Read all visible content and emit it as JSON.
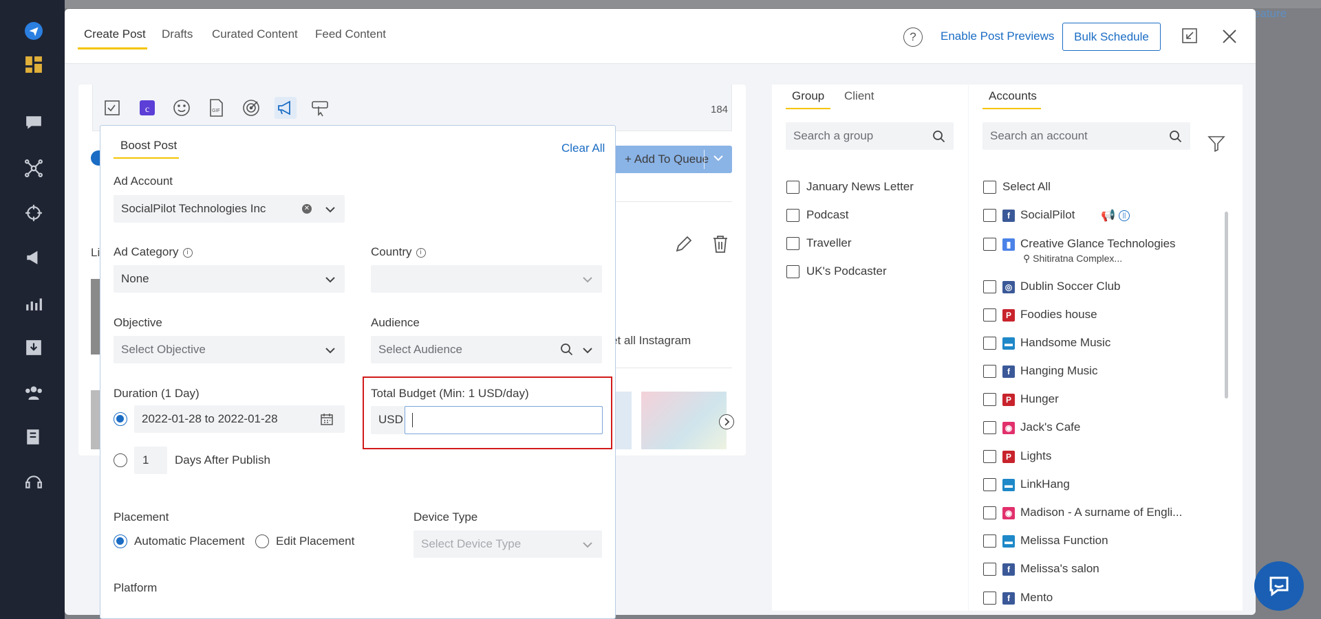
{
  "background": {
    "feature_text": "eature"
  },
  "modal": {
    "tabs": [
      "Create Post",
      "Drafts",
      "Curated Content",
      "Feed Content"
    ],
    "help_icon": "?",
    "enable_previews": "Enable Post Previews",
    "bulk_schedule": "Bulk Schedule"
  },
  "editor": {
    "char_count": "184",
    "add_to_queue": "+ Add To Queue",
    "li_text": "Li",
    "instagram_text": "et all Instagram"
  },
  "boost": {
    "title": "Boost Post",
    "clear_all": "Clear All",
    "ad_account_label": "Ad Account",
    "ad_account_value": "SocialPilot Technologies Inc",
    "ad_category_label": "Ad Category",
    "ad_category_value": "None",
    "country_label": "Country",
    "objective_label": "Objective",
    "objective_placeholder": "Select Objective",
    "audience_label": "Audience",
    "audience_placeholder": "Select Audience",
    "duration_label": "Duration (1 Day)",
    "date_range": "2022-01-28 to 2022-01-28",
    "days_value": "1",
    "days_after_publish": "Days After Publish",
    "budget_label": "Total Budget (Min: 1 USD/day)",
    "currency": "USD",
    "placement_label": "Placement",
    "automatic_placement": "Automatic Placement",
    "edit_placement": "Edit Placement",
    "device_type_label": "Device Type",
    "device_type_placeholder": "Select Device Type",
    "platform_label": "Platform"
  },
  "groups": {
    "tabs": [
      "Group",
      "Client"
    ],
    "search_placeholder": "Search a group",
    "items": [
      "January News Letter",
      "Podcast",
      "Traveller",
      "UK's Podcaster"
    ]
  },
  "accounts": {
    "tab": "Accounts",
    "search_placeholder": "Search an account",
    "select_all": "Select All",
    "items": [
      {
        "name": "SocialPilot",
        "network": "facebook"
      },
      {
        "name": "Creative Glance Technologies",
        "network": "google",
        "location": "Shitiratna Complex..."
      },
      {
        "name": "Dublin Soccer Club",
        "network": "facebook-group"
      },
      {
        "name": "Foodies house",
        "network": "pinterest"
      },
      {
        "name": "Handsome Music",
        "network": "linkedin-page"
      },
      {
        "name": "Hanging Music",
        "network": "facebook"
      },
      {
        "name": "Hunger",
        "network": "pinterest"
      },
      {
        "name": "Jack's Cafe",
        "network": "instagram"
      },
      {
        "name": "Lights",
        "network": "pinterest"
      },
      {
        "name": "LinkHang",
        "network": "linkedin-page"
      },
      {
        "name": "Madison - A surname of Engli...",
        "network": "instagram"
      },
      {
        "name": "Melissa Function",
        "network": "linkedin-page"
      },
      {
        "name": "Melissa's salon",
        "network": "facebook"
      },
      {
        "name": "Mento",
        "network": "facebook"
      }
    ]
  },
  "colors": {
    "accent": "#1a6cc4",
    "tab_underline": "#f5c400",
    "highlight_box": "#d11a1a",
    "sidebar_bg": "#1f2433",
    "facebook": "#3b5998",
    "pinterest": "#c8232c",
    "linkedin": "#1e88c8",
    "instagram": "#e1306c"
  }
}
